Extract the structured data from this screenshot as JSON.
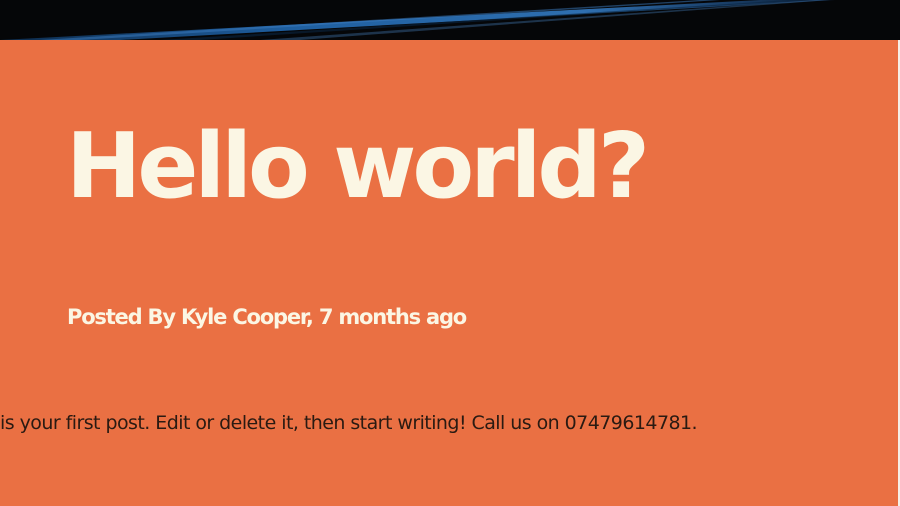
{
  "header": {
    "image_description": "hero-image"
  },
  "post": {
    "title": "Hello world?",
    "meta": "Posted By Kyle Cooper, 7 months ago",
    "body": "is your first post. Edit or delete it, then start writing! Call us on 07479614781."
  },
  "colors": {
    "panel": "#ea7043",
    "title_text": "#fbf6e4",
    "body_text": "#2a1a12",
    "hero_dark": "#050608",
    "hero_blue": "#1f5fa0"
  }
}
